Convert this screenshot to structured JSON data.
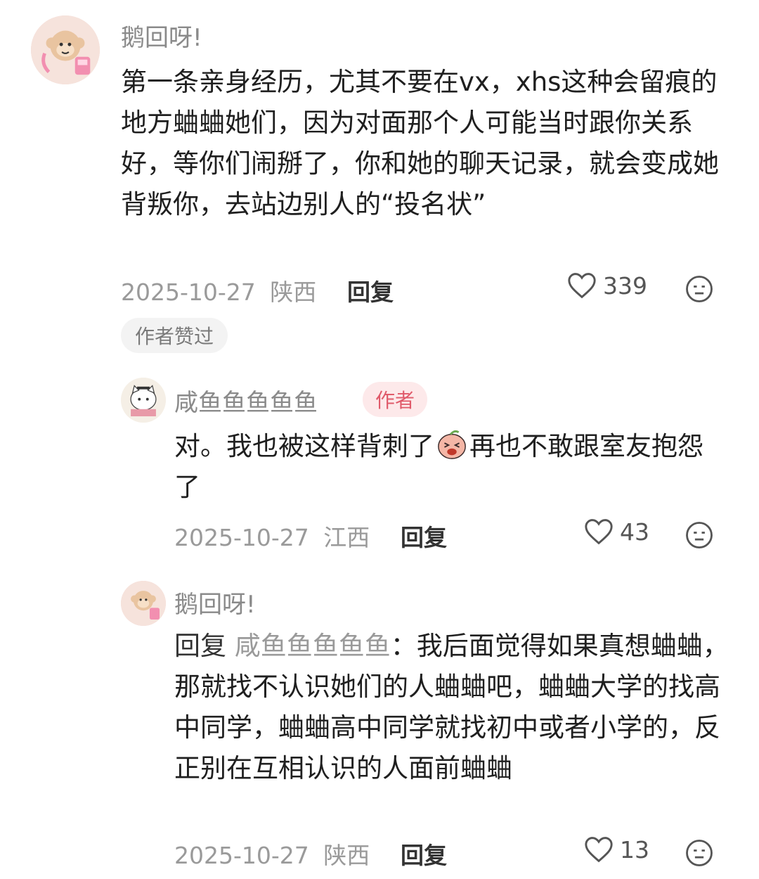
{
  "comment1": {
    "username": "鹅回呀!",
    "text": "第一条亲身经历，尤其不要在vx，xhs这种会留痕的地方蛐蛐她们，因为对面那个人可能当时跟你关系好，等你们闹掰了，你和她的聊天记录，就会变成她背叛你，去站边别人的“投名状”",
    "date": "2025-10-27",
    "location": "陕西",
    "reply_label": "回复",
    "likes": "339",
    "author_liked_badge": "作者赞过"
  },
  "reply1": {
    "username": "咸鱼鱼鱼鱼鱼",
    "author_badge": "作者",
    "text_before_emoji": "对。我也被这样背刺了",
    "text_after_emoji": "再也不敢跟室友抱怨了",
    "date": "2025-10-27",
    "location": "江西",
    "reply_label": "回复",
    "likes": "43"
  },
  "reply2": {
    "username": "鹅回呀!",
    "reply_prefix": "回复",
    "reply_target": "咸鱼鱼鱼鱼鱼",
    "text": "：我后面觉得如果真想蛐蛐，那就找不认识她们的人蛐蛐吧，蛐蛐大学的找高中同学，蛐蛐高中同学就找初中或者小学的，反正别在互相认识的人面前蛐蛐",
    "date": "2025-10-27",
    "location": "陕西",
    "reply_label": "回复",
    "likes": "13"
  },
  "icons": {
    "like": "heart-outline-icon",
    "emoji": "emoji-face-icon",
    "inline": "crying-peach-emoji"
  }
}
